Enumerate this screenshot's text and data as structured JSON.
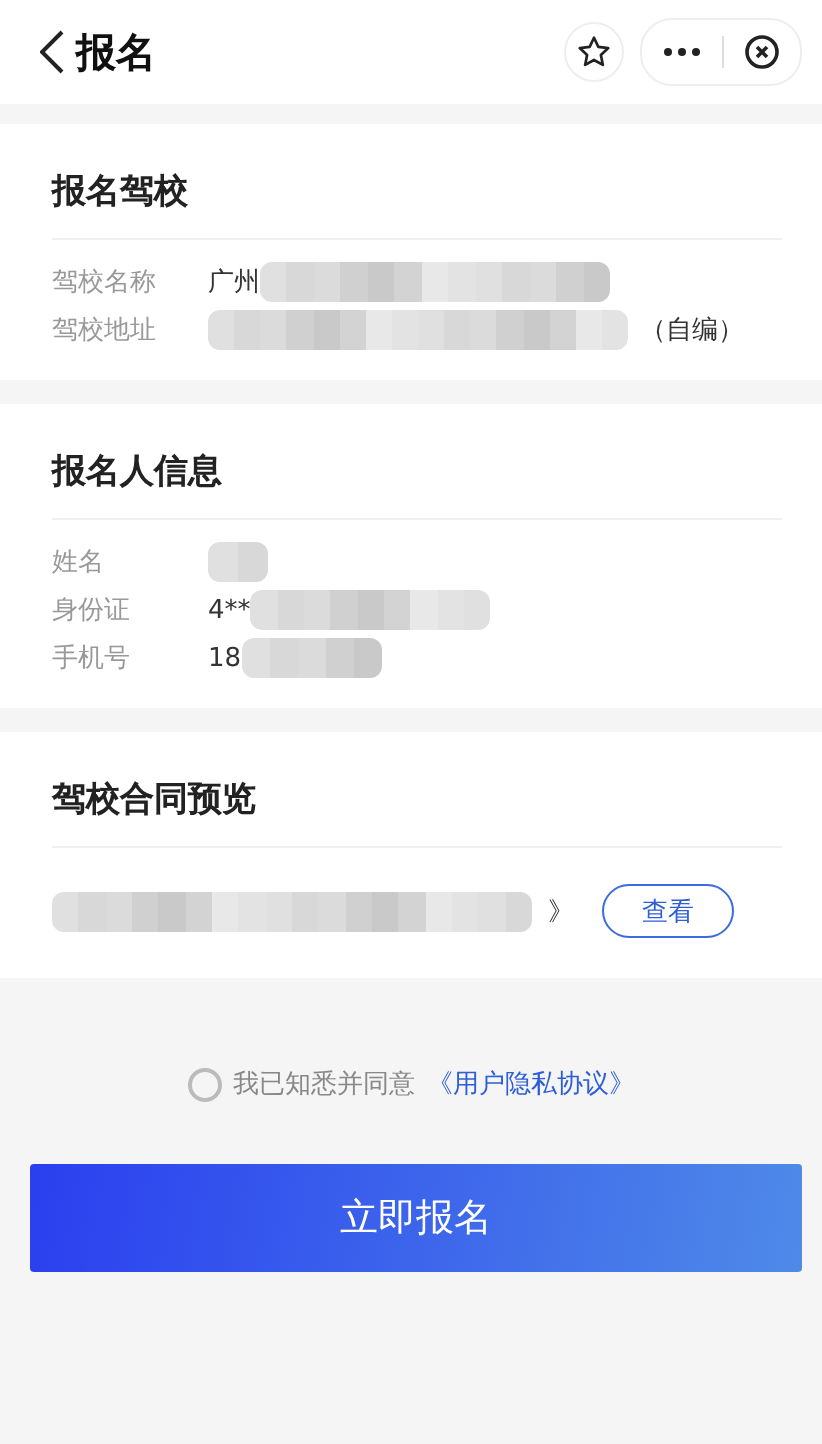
{
  "header": {
    "title": "报名"
  },
  "sections": [
    {
      "title": "报名驾校",
      "rows": [
        {
          "label": "驾校名称",
          "value": "广州",
          "redacted": true
        },
        {
          "label": "驾校地址",
          "value": "",
          "redacted": true,
          "suffix": "（自编）"
        }
      ]
    },
    {
      "title": "报名人信息",
      "rows": [
        {
          "label": "姓名",
          "value": "",
          "redacted": true
        },
        {
          "label": "身份证",
          "value": "4**",
          "redacted": true
        },
        {
          "label": "手机号",
          "value": "18",
          "redacted": true
        }
      ]
    },
    {
      "title": "驾校合同预览",
      "contract": {
        "redacted": true,
        "mark": "》",
        "button": "查看"
      }
    }
  ],
  "agreement": {
    "checked": false,
    "text": "我已知悉并同意",
    "link": "《用户隐私协议》"
  },
  "submit": "立即报名"
}
